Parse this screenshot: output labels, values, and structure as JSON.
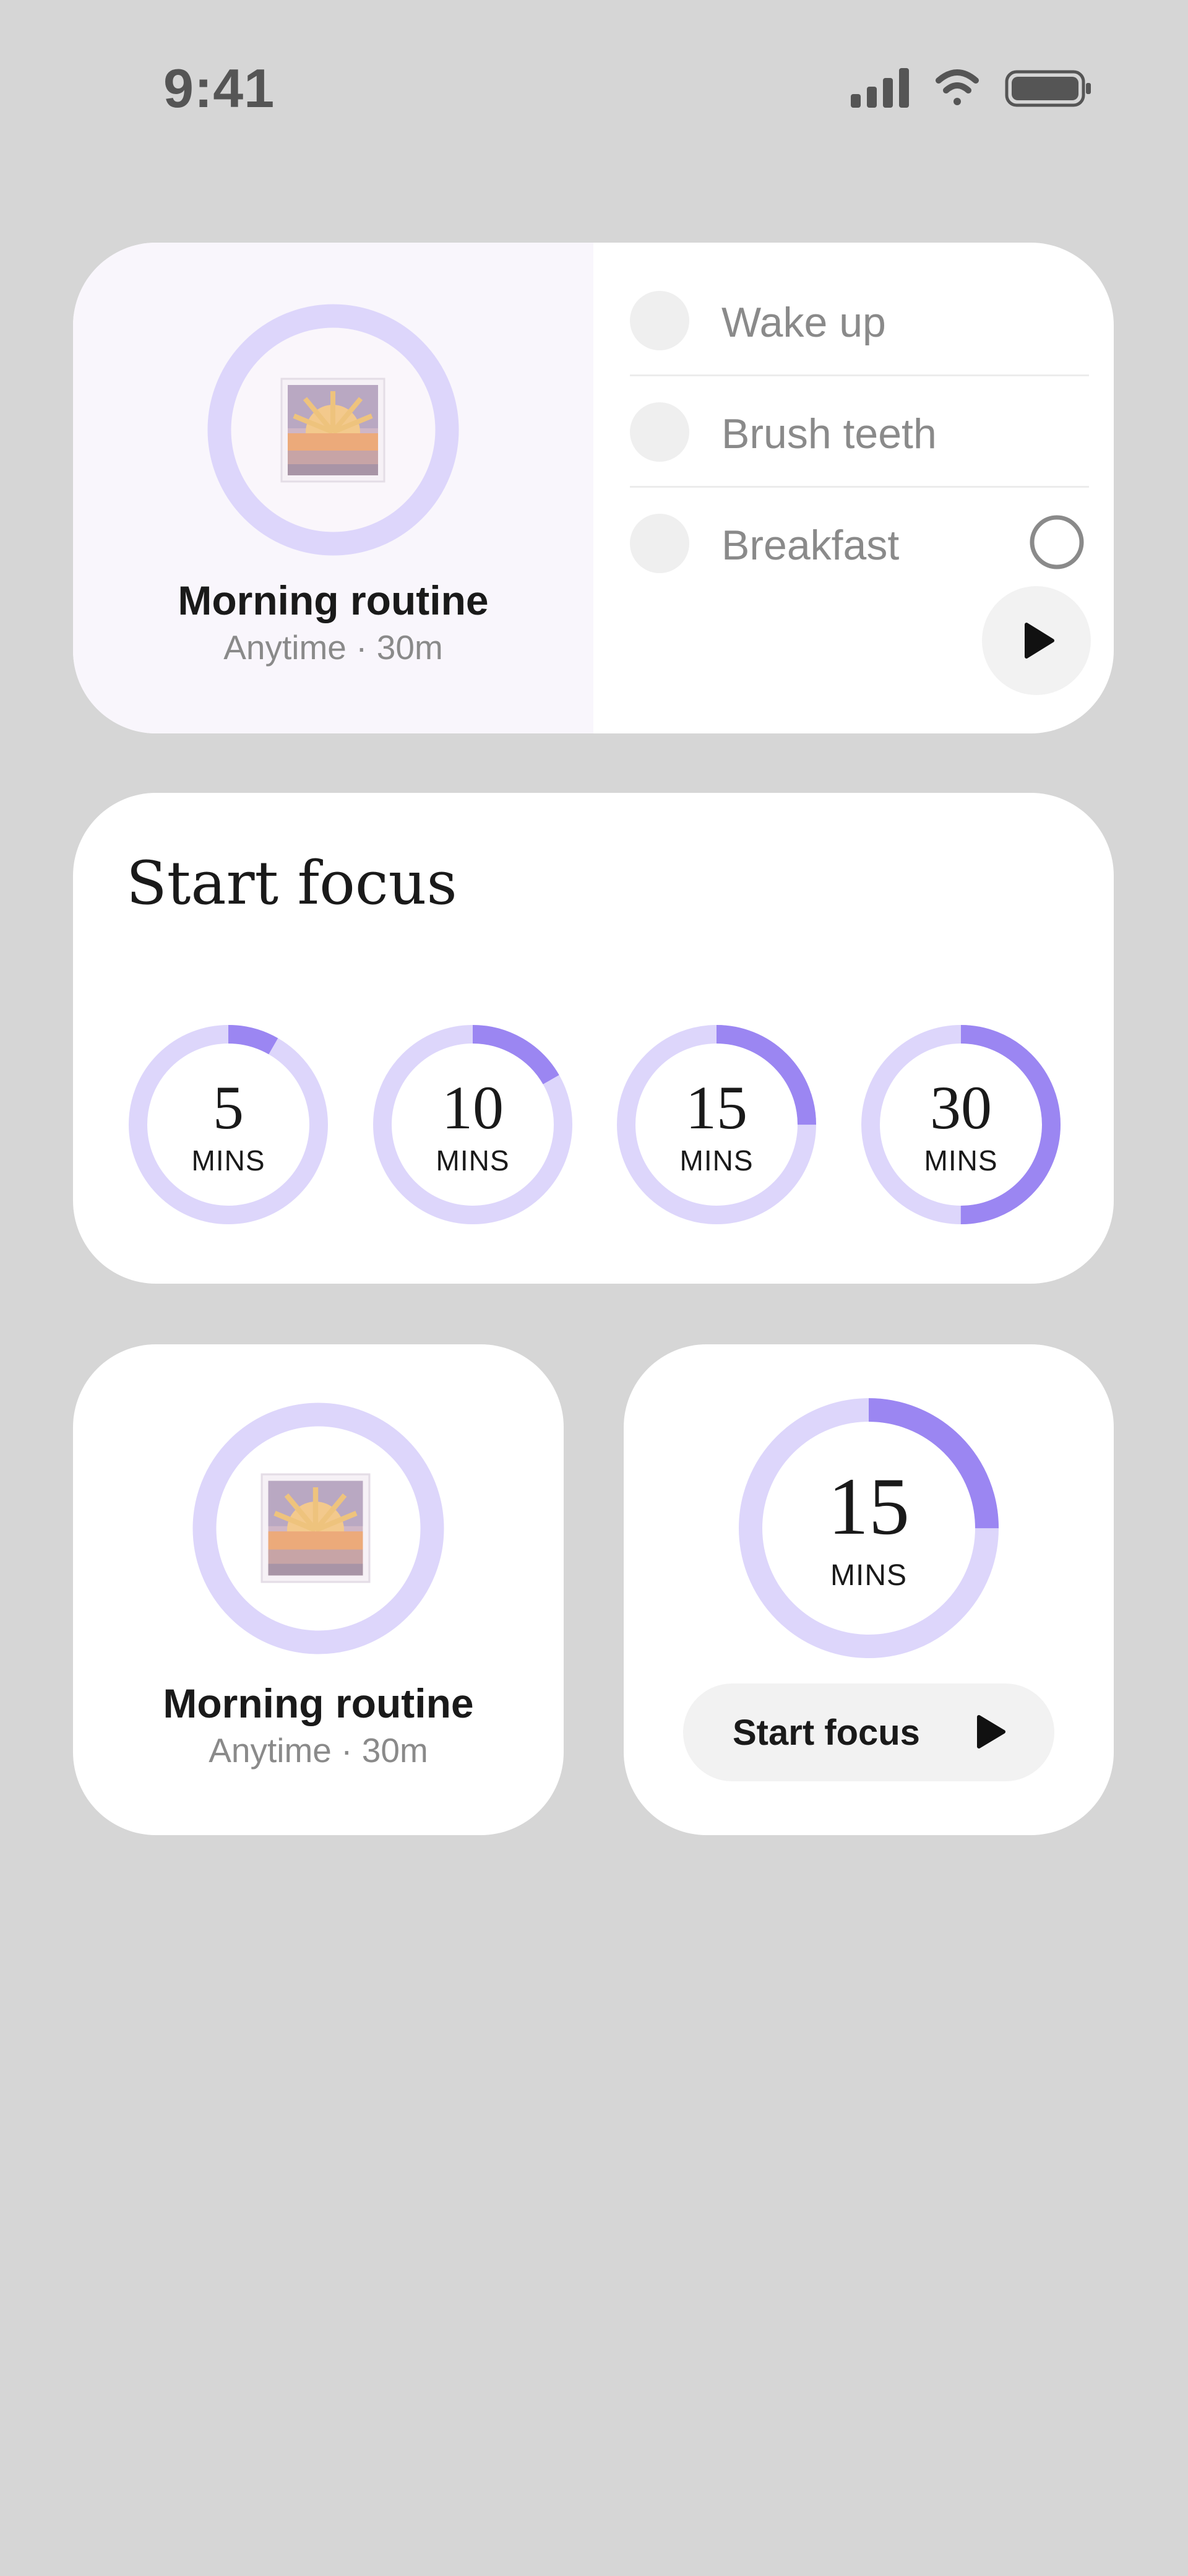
{
  "status_bar": {
    "time": "9:41",
    "icons": [
      "cellular-signal-icon",
      "wifi-icon",
      "battery-icon"
    ]
  },
  "routine_widget_large": {
    "title": "Morning routine",
    "subtitle": "Anytime · 30m",
    "tasks": [
      {
        "label": "Wake up"
      },
      {
        "label": "Brush teeth"
      },
      {
        "label": "Breakfast"
      }
    ]
  },
  "focus_widget_large": {
    "title": "Start focus",
    "timers": [
      {
        "value": "5",
        "unit": "MINS",
        "progress": 0.083
      },
      {
        "value": "10",
        "unit": "MINS",
        "progress": 0.167
      },
      {
        "value": "15",
        "unit": "MINS",
        "progress": 0.25
      },
      {
        "value": "30",
        "unit": "MINS",
        "progress": 0.5
      }
    ]
  },
  "routine_widget_small": {
    "title": "Morning routine",
    "subtitle": "Anytime · 30m"
  },
  "focus_widget_small": {
    "value": "15",
    "unit": "MINS",
    "progress": 0.25,
    "button_label": "Start focus"
  },
  "colors": {
    "background": "#d6d6d6",
    "ring_track": "#ddd6fb",
    "ring_progress": "#9b86f2",
    "card_left_panel": "#f9f6fc"
  }
}
